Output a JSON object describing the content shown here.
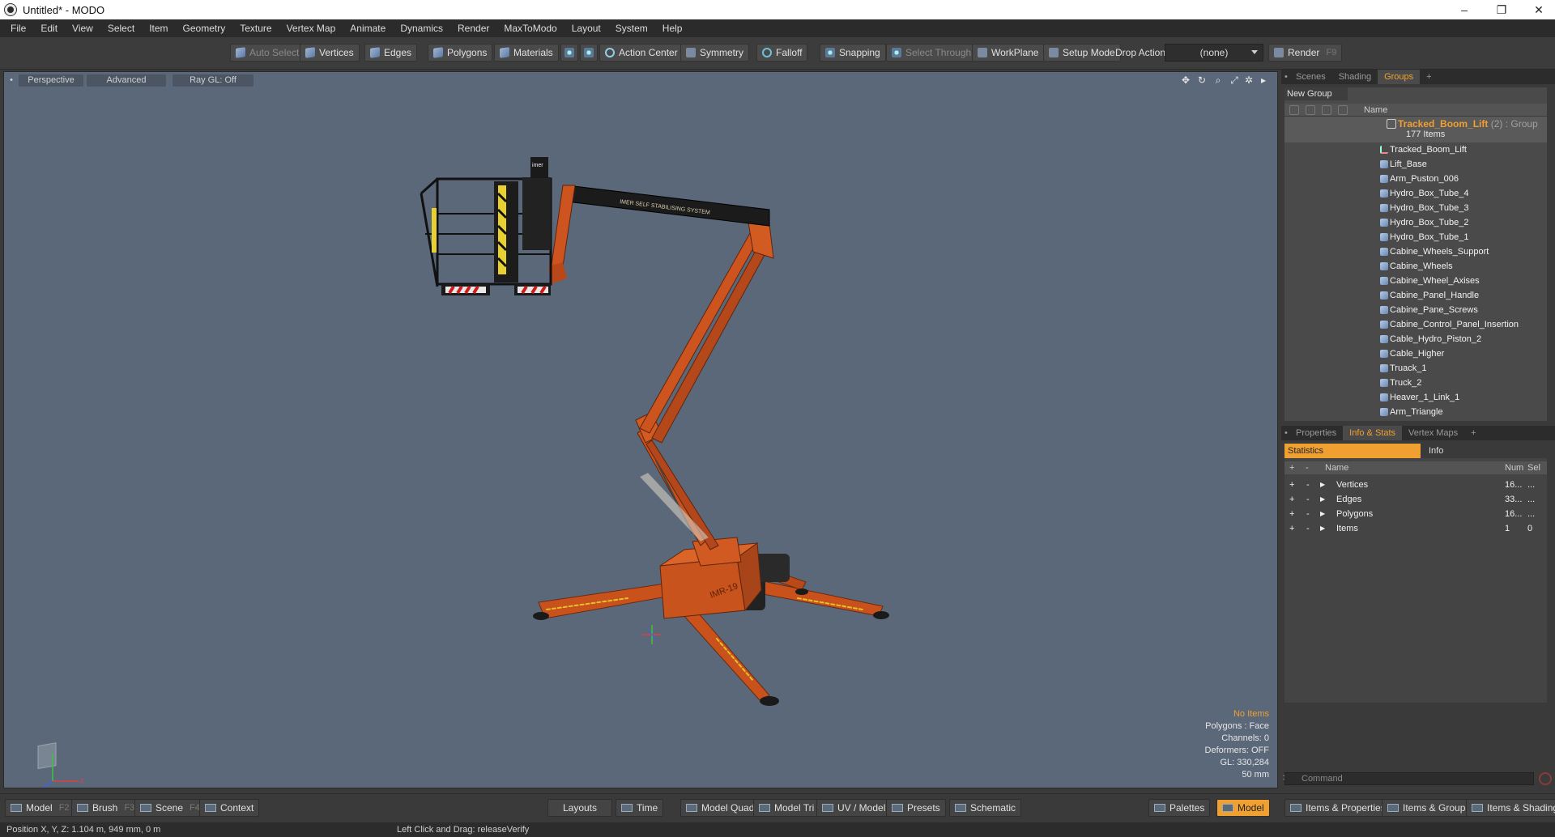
{
  "window": {
    "title": "Untitled* - MODO",
    "controls": [
      "–",
      "❐",
      "✕"
    ]
  },
  "menu": [
    "File",
    "Edit",
    "View",
    "Select",
    "Item",
    "Geometry",
    "Texture",
    "Vertex Map",
    "Animate",
    "Dynamics",
    "Render",
    "MaxToModo",
    "Layout",
    "System",
    "Help"
  ],
  "toolbar": {
    "auto_select": "Auto Select",
    "vertices": "Vertices",
    "edges": "Edges",
    "polygons": "Polygons",
    "materials": "Materials",
    "action_center": "Action Center",
    "symmetry": "Symmetry",
    "falloff": "Falloff",
    "snapping": "Snapping",
    "select_through": "Select Through",
    "workplane": "WorkPlane",
    "setup_mode": "Setup Mode",
    "drop_action_label": "Drop Action",
    "drop_action_value": "(none)",
    "render": "Render",
    "render_key": "F9"
  },
  "viewport": {
    "tabs": {
      "perspective": "Perspective",
      "advanced": "Advanced",
      "raygl": "Ray GL: Off"
    },
    "stats": {
      "selection": "No Items",
      "polygons": "Polygons : Face",
      "channels": "Channels: 0",
      "deformers": "Deformers: OFF",
      "gl": "GL: 330,284",
      "scale": "50 mm"
    },
    "model_labels": {
      "badge": "IMR-19",
      "boom_text": "IMER SELF STABILISING SYSTEM",
      "bucket_logo": "imer"
    }
  },
  "groups_panel": {
    "tabs": {
      "scenes": "Scenes",
      "shading": "Shading",
      "groups": "Groups",
      "add": "+"
    },
    "new_group": "New Group",
    "column_name": "Name",
    "group": {
      "name": "Tracked_Boom_Lift",
      "tag": "(2) : Group",
      "count": "177 Items"
    },
    "items": [
      "Tracked_Boom_Lift",
      "Lift_Base",
      "Arm_Puston_006",
      "Hydro_Box_Tube_4",
      "Hydro_Box_Tube_3",
      "Hydro_Box_Tube_2",
      "Hydro_Box_Tube_1",
      "Cabine_Wheels_Support",
      "Cabine_Wheels",
      "Cabine_Wheel_Axises",
      "Cabine_Panel_Handle",
      "Cabine_Pane_Screws",
      "Cabine_Control_Panel_Insertion",
      "Cable_Hydro_Piston_2",
      "Cable_Higher",
      "Truack_1",
      "Truck_2",
      "Heaver_1_Link_1",
      "Arm_Triangle"
    ]
  },
  "stats_panel": {
    "tabs": {
      "properties": "Properties",
      "info_stats": "Info & Stats",
      "vertex_maps": "Vertex Maps",
      "add": "+"
    },
    "subtabs": {
      "statistics": "Statistics",
      "info": "Info"
    },
    "columns": {
      "plus": "+",
      "minus": "-",
      "name": "Name",
      "num": "Num",
      "sel": "Sel"
    },
    "rows": [
      {
        "name": "Vertices",
        "num": "16...",
        "sel": "..."
      },
      {
        "name": "Edges",
        "num": "33...",
        "sel": "..."
      },
      {
        "name": "Polygons",
        "num": "16...",
        "sel": "..."
      },
      {
        "name": "Items",
        "num": "1",
        "sel": "0"
      }
    ],
    "command_placeholder": "Command"
  },
  "bottombar": {
    "model": "Model",
    "model_key": "F2",
    "brush": "Brush",
    "brush_key": "F3",
    "scene": "Scene",
    "scene_key": "F4",
    "context": "Context",
    "layouts": "Layouts",
    "time": "Time",
    "model_quad": "Model Quad",
    "model_tri": "Model Tri",
    "uv_model": "UV / Model",
    "presets": "Presets",
    "schematic": "Schematic",
    "palettes": "Palettes",
    "model_active": "Model",
    "items_properties": "Items & Properties",
    "items_groups": "Items & Groups",
    "items_shading": "Items & Shading"
  },
  "status": {
    "position": "Position X, Y, Z:   1.104 m, 949 mm, 0 m",
    "hint": "Left Click and Drag:   releaseVerify"
  },
  "colors": {
    "accent": "#f0a030",
    "viewport_bg": "#5b6879",
    "machine": "#d2581f",
    "panel": "#3a3a3a"
  }
}
